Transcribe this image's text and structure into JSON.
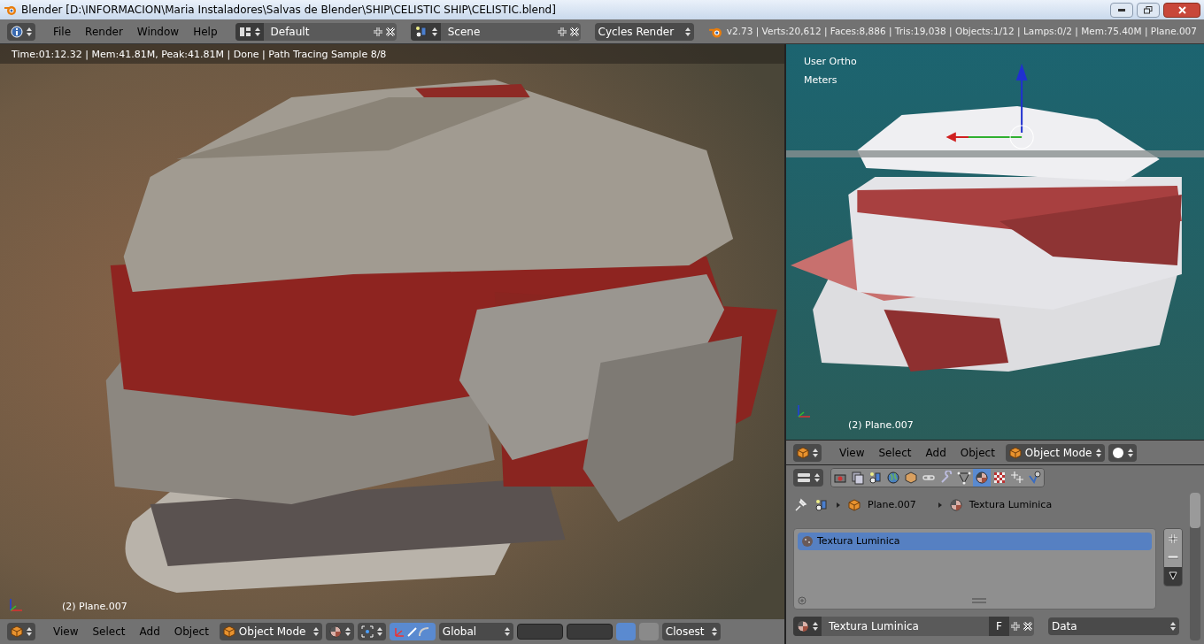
{
  "window": {
    "title": "Blender [D:\\INFORMACION\\Maria Instaladores\\Salvas de Blender\\SHIP\\CELISTIC SHIP\\CELISTIC.blend]"
  },
  "top_header": {
    "menus": [
      "File",
      "Render",
      "Window",
      "Help"
    ],
    "layout": "Default",
    "scene": "Scene",
    "engine": "Cycles Render",
    "stats": "v2.73 | Verts:20,612 | Faces:8,886 | Tris:19,038 | Objects:1/12 | Lamps:0/2 | Mem:75.40M | Plane.007"
  },
  "render_view": {
    "status": "Time:01:12.32 | Mem:41.81M, Peak:41.81M | Done | Path Tracing Sample 8/8",
    "object_label": "(2) Plane.007"
  },
  "bottom_header": {
    "menus": [
      "View",
      "Select",
      "Add",
      "Object"
    ],
    "mode": "Object Mode",
    "orientation": "Global",
    "snap": "Closest",
    "manipulator_on": true,
    "lock_camera_on": true,
    "snap_on": false
  },
  "viewport": {
    "view_name": "User Ortho",
    "units": "Meters",
    "object_label": "(2) Plane.007"
  },
  "viewport_header": {
    "menus": [
      "View",
      "Select",
      "Add",
      "Object"
    ],
    "mode": "Object Mode"
  },
  "properties": {
    "tabs": [
      {
        "kind": "render",
        "selected": false
      },
      {
        "kind": "layers",
        "selected": false
      },
      {
        "kind": "scene",
        "selected": false
      },
      {
        "kind": "world",
        "selected": false
      },
      {
        "kind": "object",
        "selected": false
      },
      {
        "kind": "constraints",
        "selected": false
      },
      {
        "kind": "modifiers",
        "selected": false
      },
      {
        "kind": "data",
        "selected": false
      },
      {
        "kind": "material",
        "selected": true
      },
      {
        "kind": "texture",
        "selected": false
      },
      {
        "kind": "particles",
        "selected": false
      },
      {
        "kind": "physics",
        "selected": false
      }
    ],
    "breadcrumb": [
      "Plane.007",
      "Textura Luminica"
    ],
    "slots": [
      {
        "name": "Textura Luminica",
        "selected": true
      }
    ],
    "material": "Textura Luminica",
    "users": "F",
    "link": "Data"
  }
}
